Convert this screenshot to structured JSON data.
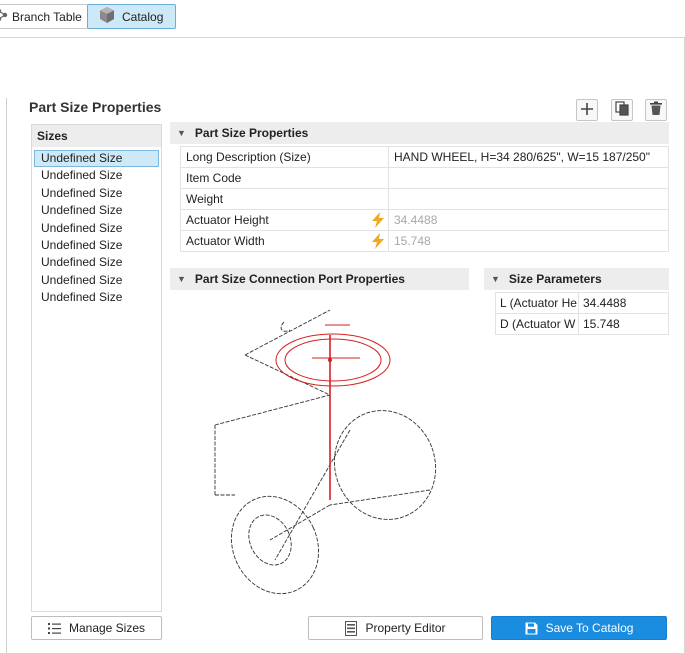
{
  "tabs": [
    {
      "label": "Branch Table",
      "icon": "branch-icon",
      "active": false
    },
    {
      "label": "Catalog",
      "icon": "cube-icon",
      "active": true
    }
  ],
  "page": {
    "title": "Part Size Properties"
  },
  "toolbar": {
    "add_icon": "plus-icon",
    "copy_icon": "copy-icon",
    "delete_icon": "trash-icon"
  },
  "sizes": {
    "header": "Sizes",
    "items": [
      "Undefined Size",
      "Undefined Size",
      "Undefined Size",
      "Undefined Size",
      "Undefined Size",
      "Undefined Size",
      "Undefined Size",
      "Undefined Size",
      "Undefined Size"
    ],
    "selected_index": 0
  },
  "properties": {
    "header": "Part Size Properties",
    "rows": [
      {
        "name": "Long Description (Size)",
        "value": "HAND WHEEL, H=34 280/625\", W=15 187/250\"",
        "formula": false
      },
      {
        "name": "Item Code",
        "value": "",
        "formula": false
      },
      {
        "name": "Weight",
        "value": "",
        "formula": false
      },
      {
        "name": "Actuator Height",
        "value": "34.4488",
        "formula": true
      },
      {
        "name": "Actuator Width",
        "value": "15.748",
        "formula": true
      }
    ]
  },
  "connection_ports": {
    "header": "Part Size Connection Port Properties"
  },
  "size_parameters": {
    "header": "Size Parameters",
    "rows": [
      {
        "name": "L (Actuator He",
        "value": "34.4488"
      },
      {
        "name": "D (Actuator W",
        "value": "15.748"
      }
    ]
  },
  "buttons": {
    "manage_sizes": "Manage Sizes",
    "property_editor": "Property Editor",
    "save_to_catalog": "Save To Catalog"
  },
  "colors": {
    "accent": "#1a8de0",
    "selected": "#cde8f7",
    "formula": "#f2a81d",
    "drawing_highlight": "#d62020"
  }
}
